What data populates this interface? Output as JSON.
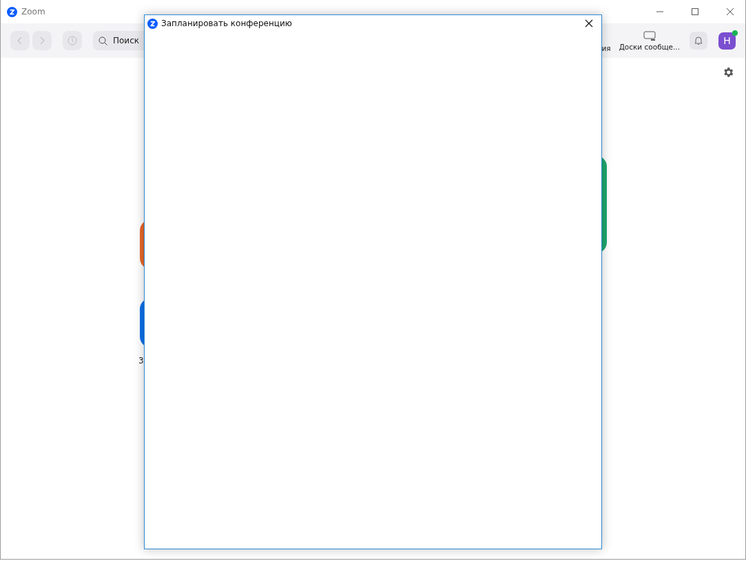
{
  "window": {
    "title": "Zoom"
  },
  "toolbar": {
    "search": {
      "placeholder": "Поиск"
    },
    "items": [
      {
        "label": "ия"
      },
      {
        "label": "Доски сообще..."
      }
    ],
    "avatar": {
      "initial": "H",
      "online": true
    }
  },
  "home": {
    "tiles": [
      {
        "color": "#e8692a"
      },
      {
        "color": "#0e71eb",
        "label": "3"
      }
    ],
    "side_tile": {
      "color": "#1fa86e"
    }
  },
  "dialog": {
    "title": "Запланировать конференцию"
  }
}
